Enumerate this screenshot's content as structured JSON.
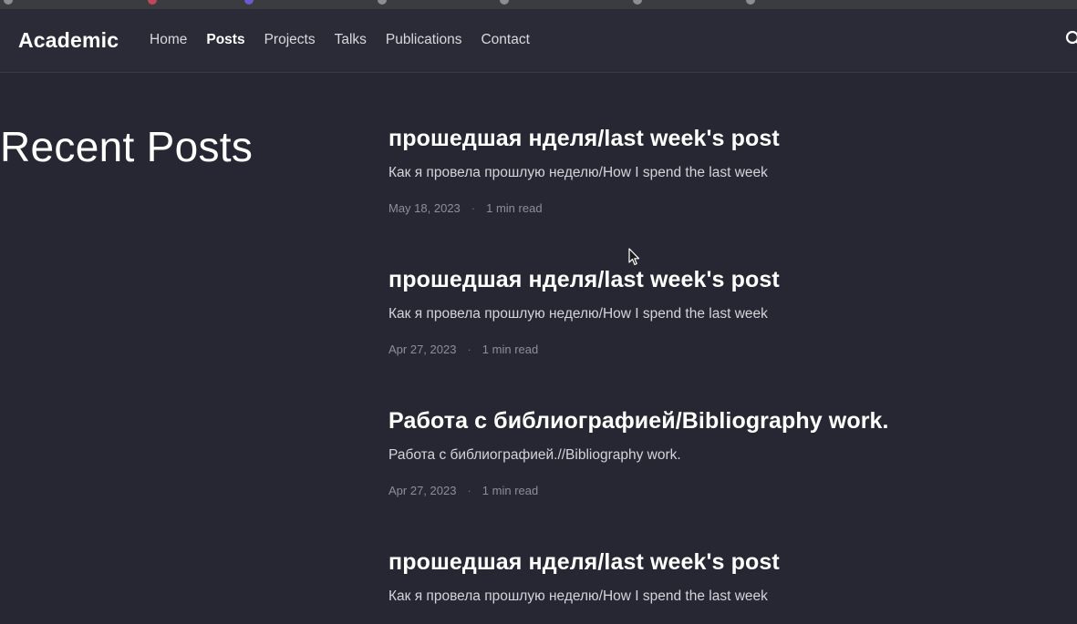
{
  "navbar": {
    "brand": "Academic",
    "links": [
      {
        "label": "Home",
        "active": false
      },
      {
        "label": "Posts",
        "active": true
      },
      {
        "label": "Projects",
        "active": false
      },
      {
        "label": "Talks",
        "active": false
      },
      {
        "label": "Publications",
        "active": false
      },
      {
        "label": "Contact",
        "active": false
      }
    ],
    "search_icon": "search-icon"
  },
  "section": {
    "title": "Recent Posts"
  },
  "posts": [
    {
      "title": "прошедшая нделя/last week's post",
      "summary": "Как я провела прошлую неделю/How I spend the last week",
      "date": "May 18, 2023",
      "read_time": "1 min read"
    },
    {
      "title": "прошедшая нделя/last week's post",
      "summary": "Как я провела прошлую неделю/How I spend the last week",
      "date": "Apr 27, 2023",
      "read_time": "1 min read"
    },
    {
      "title": "Работа с библиографией/Bibliography work.",
      "summary": "Работа с библиографией.//Bibliography work.",
      "date": "Apr 27, 2023",
      "read_time": "1 min read"
    },
    {
      "title": "прошедшая нделя/last week's post",
      "summary": "Как я провела прошлую неделю/How I spend the last week",
      "date": "",
      "read_time": ""
    }
  ],
  "meta_separator": "·",
  "colors": {
    "background": "#272733",
    "navbar": "#2b2b37",
    "text": "#ffffff",
    "muted": "#8e8e98"
  }
}
